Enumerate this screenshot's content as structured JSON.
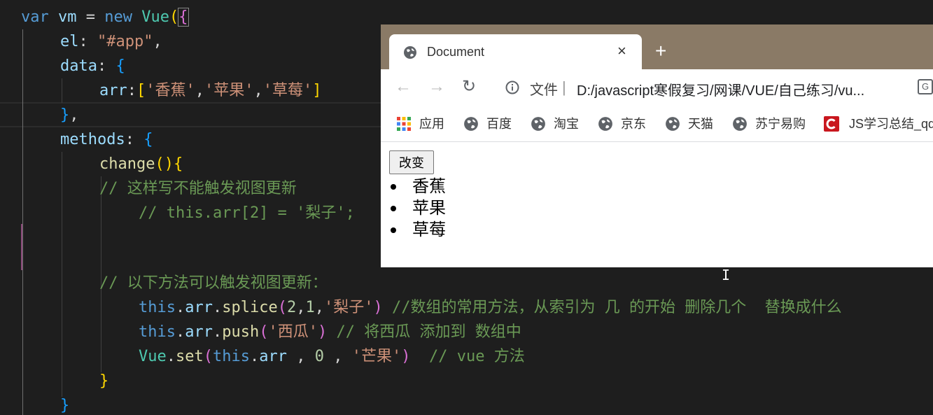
{
  "editor": {
    "line0": {
      "t1": "var",
      "t2": "vm",
      "t3": " = ",
      "t4": "new",
      "t5": "Vue",
      "t6": "(",
      "t7": "{"
    },
    "line1": {
      "t1": "el",
      "t2": ": ",
      "t3": "\"#app\"",
      "t4": ","
    },
    "line2": {
      "t1": "data",
      "t2": ": ",
      "t3": "{"
    },
    "line3": {
      "t1": "arr",
      "t2": ":",
      "t3": "[",
      "t4": "'香蕉'",
      "t5": ",",
      "t6": "'苹果'",
      "t7": ",",
      "t8": "'草莓'",
      "t9": "]"
    },
    "line4": {
      "t1": "}",
      "t2": ","
    },
    "line5": {
      "t1": "methods",
      "t2": ": ",
      "t3": "{"
    },
    "line6": {
      "t1": "change",
      "t2": "()",
      "t3": "{"
    },
    "line7": {
      "t1": "// 这样写不能触发视图更新"
    },
    "line8": {
      "t1": "// this.arr[2] = '梨子';"
    },
    "line11": {
      "t1": "// 以下方法可以触发视图更新："
    },
    "line12": {
      "t1": "this",
      "t2": ".",
      "t3": "arr",
      "t4": ".",
      "t5": "splice",
      "t6": "(",
      "t7": "2",
      "t8": ",",
      "t9": "1",
      "t10": ",",
      "t11": "'梨子'",
      "t12": ")",
      "t13": " //数组的常用方法，从索引为 几 的开始 删除几个  替换成什么"
    },
    "line13": {
      "t1": "this",
      "t2": ".",
      "t3": "arr",
      "t4": ".",
      "t5": "push",
      "t6": "(",
      "t7": "'西瓜'",
      "t8": ")",
      "t9": " // 将西瓜 添加到 数组中"
    },
    "line14": {
      "t1": "Vue",
      "t2": ".",
      "t3": "set",
      "t4": "(",
      "t5": "this",
      "t6": ".",
      "t7": "arr",
      "t8": " , ",
      "t9": "0",
      "t10": " , ",
      "t11": "'芒果'",
      "t12": ")",
      "t13": "  // vue 方法"
    },
    "line15": {
      "t1": "}"
    },
    "line16": {
      "t1": "}"
    }
  },
  "browser": {
    "tab_title": "Document",
    "tab_close": "×",
    "new_tab": "+",
    "back": "←",
    "forward": "→",
    "reload": "↻",
    "file_label": "文件",
    "separator": "|",
    "url": "D:/javascript寒假复习/网课/VUE/自己练习/vu...",
    "translate_glyph": "G",
    "bookmarks": [
      {
        "label": "应用"
      },
      {
        "label": "百度"
      },
      {
        "label": "淘宝"
      },
      {
        "label": "京东"
      },
      {
        "label": "天猫"
      },
      {
        "label": "苏宁易购"
      },
      {
        "label": "JS学习总结_qq"
      }
    ],
    "change_button": "改变",
    "fruits": [
      "香蕉",
      "苹果",
      "草莓"
    ]
  },
  "cursor_glyph": "I",
  "colors": {
    "editor_bg": "#1e1e1e",
    "tabbar_bg": "#8a7a66",
    "keyword": "#569cd6",
    "comment": "#6a9955",
    "string": "#ce9178"
  }
}
